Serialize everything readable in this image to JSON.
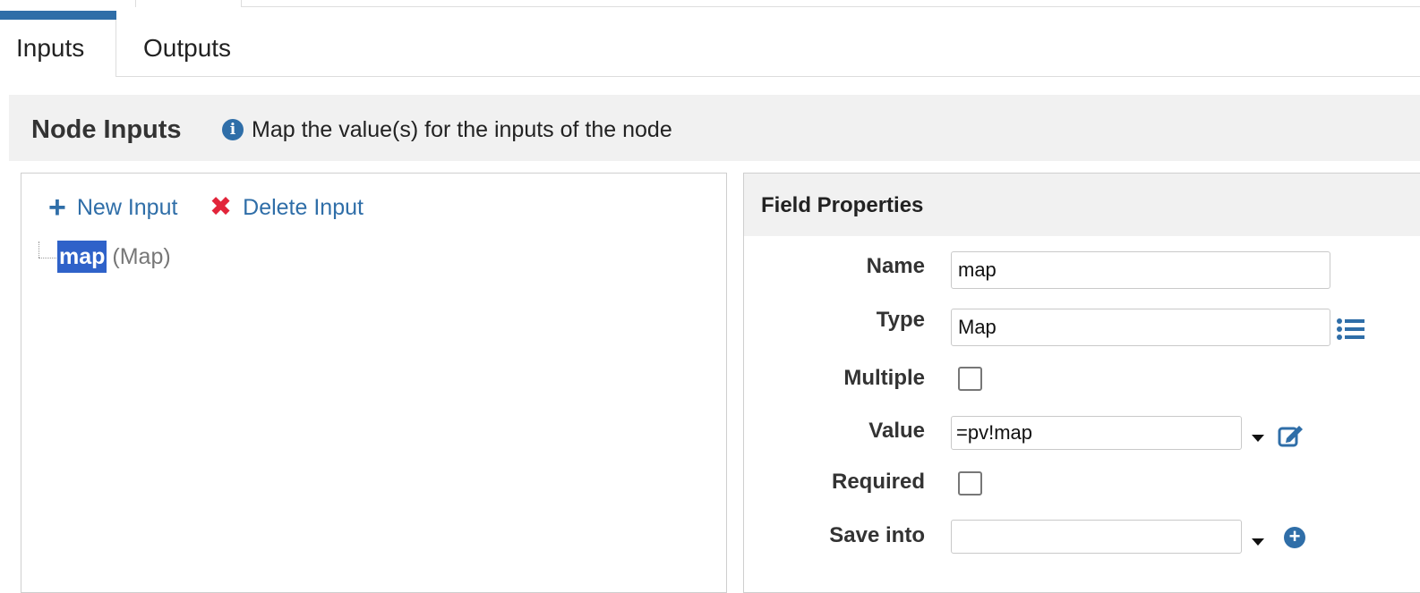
{
  "tabs": [
    {
      "label": "Inputs",
      "active": true
    },
    {
      "label": "Outputs",
      "active": false
    }
  ],
  "section": {
    "title": "Node Inputs",
    "hint": "Map the value(s) for the inputs of the node",
    "info_icon": "info-icon"
  },
  "toolbar": {
    "new_label": "New Input",
    "delete_label": "Delete Input"
  },
  "tree": {
    "items": [
      {
        "name": "map",
        "type": "(Map)",
        "selected": true
      }
    ]
  },
  "field_properties": {
    "title": "Field Properties",
    "name_label": "Name",
    "name_value": "map",
    "type_label": "Type",
    "type_value": "Map",
    "multiple_label": "Multiple",
    "multiple_checked": false,
    "value_label": "Value",
    "value_value": "=pv!map",
    "required_label": "Required",
    "required_checked": false,
    "save_into_label": "Save into",
    "save_into_value": ""
  },
  "colors": {
    "accent": "#2f6ea8",
    "selection": "#2f62c9",
    "delete": "#e2243a",
    "header_bg": "#f1f1f1"
  }
}
